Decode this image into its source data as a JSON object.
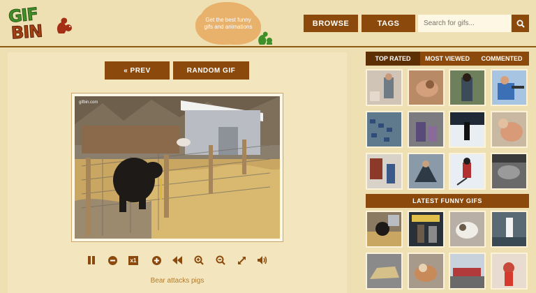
{
  "header": {
    "logo_line1": "GIF",
    "logo_line2": "BIN",
    "tagline": "Get the best funny gifs and animations",
    "nav": {
      "browse": "BROWSE",
      "tags": "TAGS"
    },
    "search": {
      "placeholder": "Search for gifs...",
      "value": ""
    }
  },
  "controls": {
    "prev": "« PREV",
    "random": "RANDOM GIF"
  },
  "gif": {
    "watermark": "gifbin.com",
    "title": "Bear attacks pigs"
  },
  "player": {
    "speed": "x1",
    "icons": [
      "pause-icon",
      "minus-icon",
      "speed-badge",
      "plus-icon",
      "rewind-icon",
      "zoom-in-icon",
      "zoom-out-icon",
      "fullscreen-icon",
      "volume-icon"
    ]
  },
  "sidebar": {
    "tabs": [
      "TOP RATED",
      "MOST VIEWED",
      "COMMENTED"
    ],
    "active_tab": "TOP RATED",
    "latest_title": "LATEST FUNNY GIFS"
  },
  "colors": {
    "background": "#efe0b3",
    "button": "#8b4a0c",
    "accent_text": "#b27a2c",
    "logo_green": "#3f8f2a",
    "logo_red": "#a34014"
  }
}
